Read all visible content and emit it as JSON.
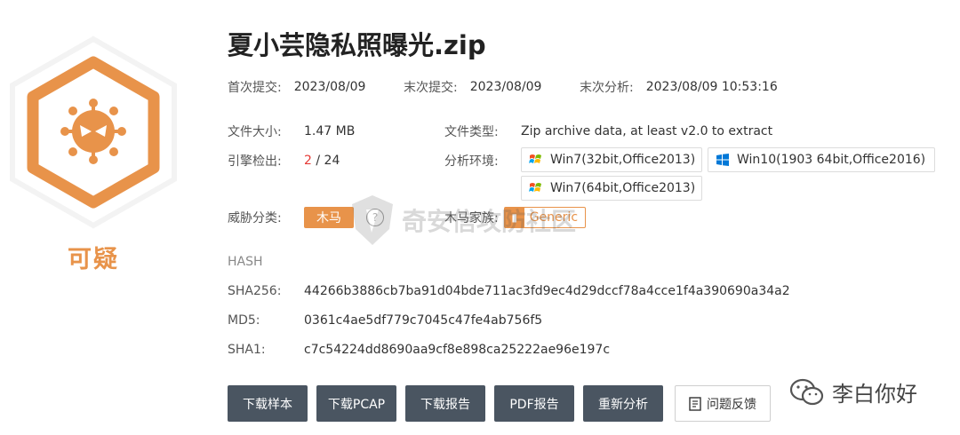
{
  "verdict": {
    "label": "可疑",
    "icon": "virus-icon",
    "color": "#e8934a"
  },
  "file": {
    "name": "夏小芸隐私照曝光.zip"
  },
  "timestamps": {
    "first_submit_label": "首次提交:",
    "first_submit_value": "2023/08/09",
    "last_submit_label": "末次提交:",
    "last_submit_value": "2023/08/09",
    "last_analysis_label": "末次分析:",
    "last_analysis_value": "2023/08/09 10:53:16"
  },
  "info": {
    "size_label": "文件大小:",
    "size_value": "1.47 MB",
    "type_label": "文件类型:",
    "type_value": "Zip archive data, at least v2.0 to extract",
    "engine_label": "引擎检出:",
    "engine_detected": "2",
    "engine_sep": " / ",
    "engine_total": "24",
    "env_label": "分析环境:",
    "envs": [
      {
        "label": "Win7(32bit,Office2013)",
        "icon": "windows7-icon"
      },
      {
        "label": "Win10(1903 64bit,Office2016)",
        "icon": "windows10-icon"
      },
      {
        "label": "Win7(64bit,Office2013)",
        "icon": "windows7-icon"
      }
    ],
    "threat_label": "威胁分类:",
    "threat_value": "木马",
    "family_label": "木马家族:",
    "family_value": "Generic"
  },
  "hash": {
    "heading": "HASH",
    "sha256_label": "SHA256:",
    "sha256_value": "44266b3886cb7ba91d04bde711ac3fd9ec4d29dccf78a4cce1f4a390690a34a2",
    "md5_label": "MD5:",
    "md5_value": "0361c4ae5df779c7045c47fe4ab756f5",
    "sha1_label": "SHA1:",
    "sha1_value": "c7c54224dd8690aa9cf8e898ca25222ae96e197c"
  },
  "actions": {
    "download_sample": "下载样本",
    "download_pcap": "下载PCAP",
    "download_report": "下载报告",
    "pdf_report": "PDF报告",
    "reanalyze": "重新分析",
    "feedback": "问题反馈"
  },
  "watermarks": {
    "center": "奇安信攻防社区",
    "bottom": "李白你好"
  },
  "colors": {
    "accent": "#e8934a",
    "danger": "#e53935",
    "button_dark": "#4a5561"
  }
}
